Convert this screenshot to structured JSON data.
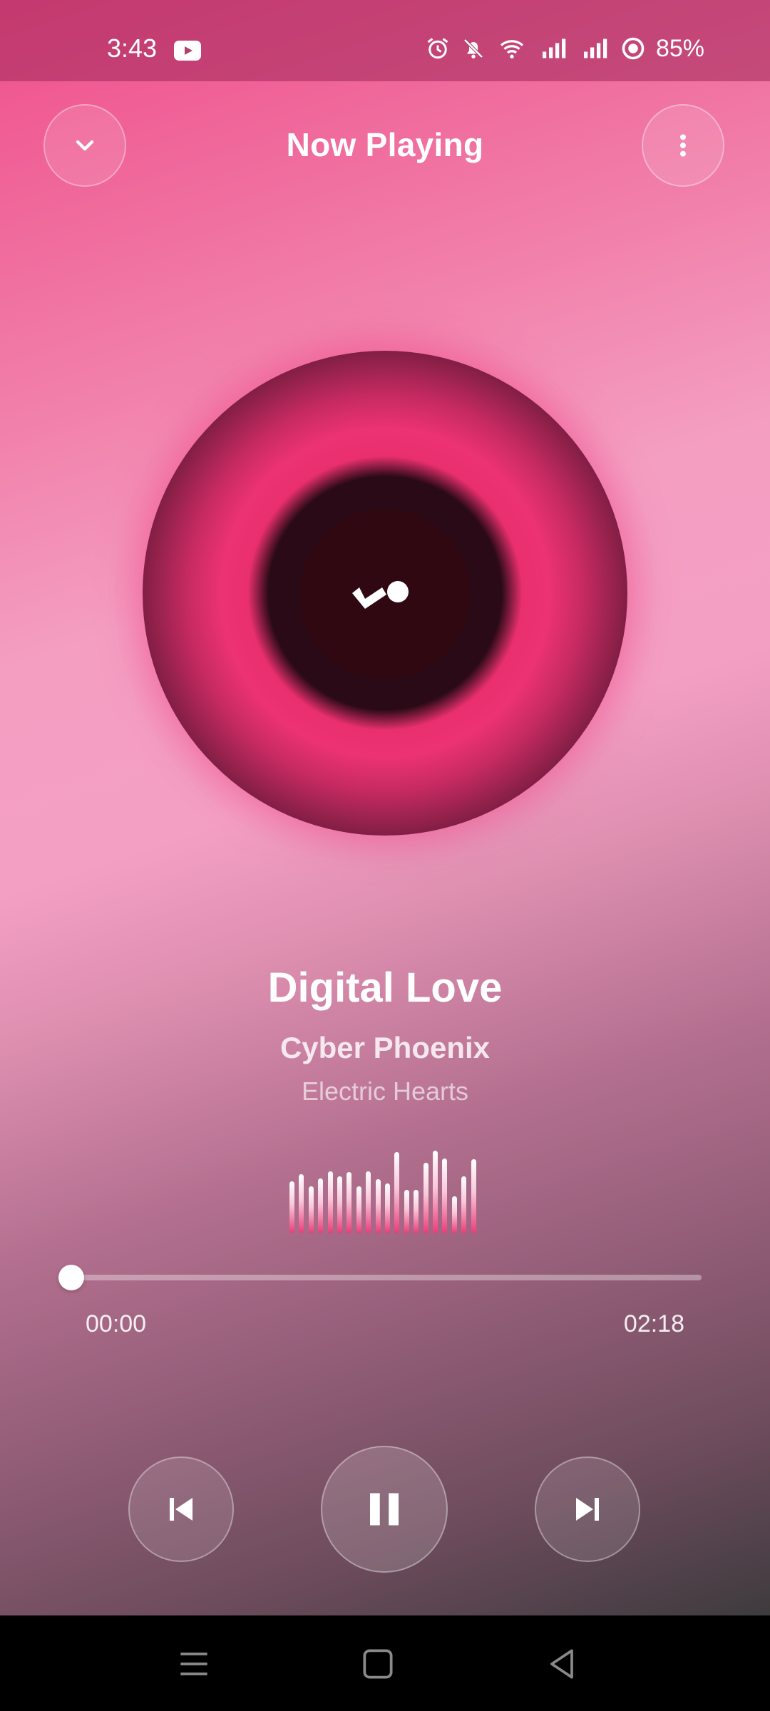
{
  "status_bar": {
    "time": "3:43",
    "battery": "85%",
    "icons": [
      "youtube-icon",
      "alarm-icon",
      "notifications-off-icon",
      "wifi-icon",
      "signal-icon",
      "signal-icon",
      "battery-saver-icon"
    ]
  },
  "header": {
    "title": "Now Playing",
    "left_icon": "chevron-down-icon",
    "right_icon": "more-vert-icon"
  },
  "song": {
    "title": "Digital Love",
    "artist": "Cyber Phoenix",
    "album": "Electric Hearts"
  },
  "visualizer": {
    "levels": [
      0.62,
      0.7,
      0.56,
      0.65,
      0.74,
      0.68,
      0.73,
      0.56,
      0.74,
      0.64,
      0.59,
      0.97,
      0.52,
      0.52,
      0.84,
      0.98,
      0.89,
      0.44,
      0.68,
      0.88
    ]
  },
  "playback": {
    "elapsed": "00:00",
    "total": "02:18",
    "progress": 0.0
  },
  "controls": {
    "previous_icon": "skip-previous-icon",
    "play_pause_icon": "pause-icon",
    "next_icon": "skip-next-icon"
  },
  "nav_bar": {
    "icons": [
      "recents-icon",
      "home-icon",
      "back-icon"
    ]
  },
  "colors": {
    "accent": "#ec3272",
    "disc_center": "#300812",
    "gradient_top": "#ef4f8b",
    "gradient_bottom": "#3e3b3d"
  }
}
